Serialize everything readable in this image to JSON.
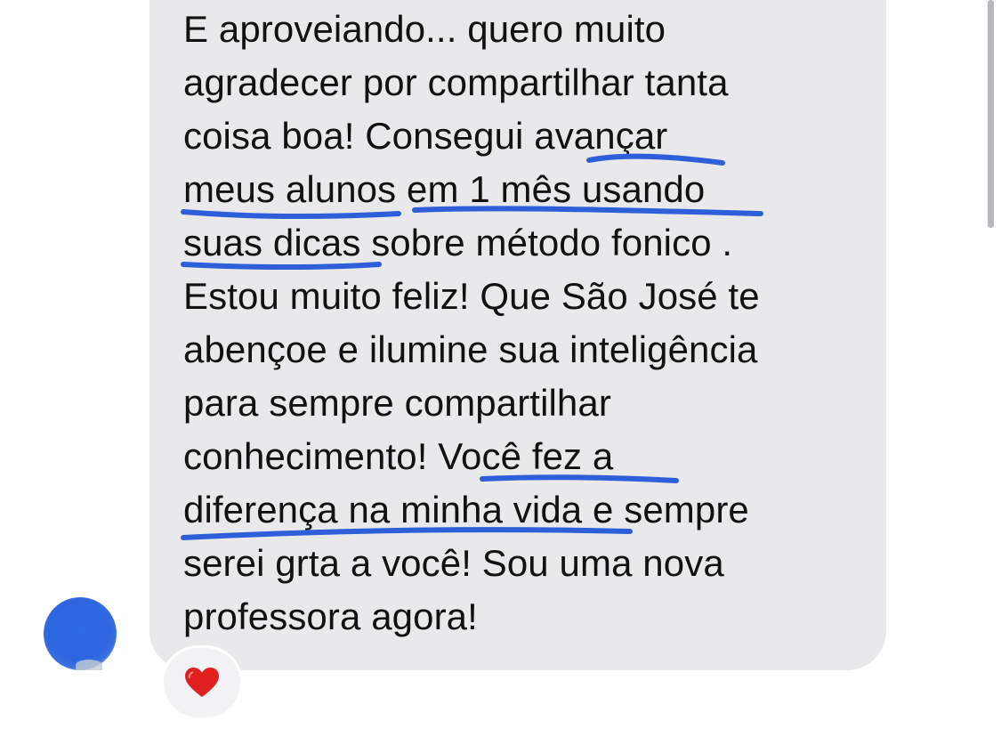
{
  "message": {
    "lines": [
      "E aproveiando... quero muito",
      "agradecer por compartilhar tanta",
      "coisa boa! Consegui avançar",
      "meus alunos em 1 mês usando",
      "suas dicas sobre método fonico .",
      "Estou muito feliz! Que São José te",
      "abençoe e ilumine sua inteligência",
      "para sempre compartilhar",
      "conhecimento! Você fez a",
      "diferença na minha vida e sempre",
      "serei grta a você! Sou uma nova",
      "professora agora!"
    ]
  },
  "reaction": {
    "icon": "red-heart-icon",
    "color": "#e0201f"
  },
  "annotation": {
    "color": "#2f5fd8"
  },
  "avatar": {
    "color": "#2d66e0"
  }
}
